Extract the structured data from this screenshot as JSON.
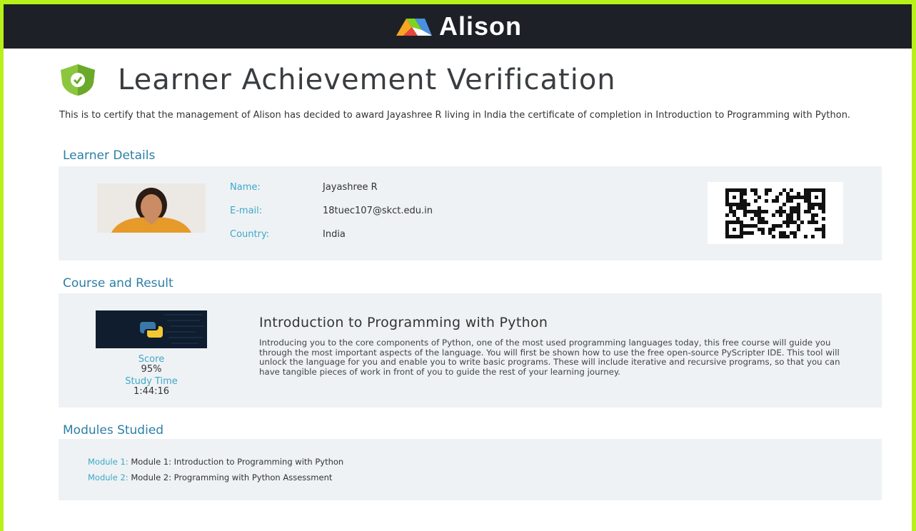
{
  "header": {
    "brand_name": "Alison",
    "bar_color": "#1d2127"
  },
  "page": {
    "title": "Learner Achievement Verification",
    "intro": "This is to certify that the management of Alison has decided to award Jayashree R living in India the certificate of completion in Introduction to Programming with Python.",
    "accent_color": "#2b7fa6",
    "border_color": "#b8f01a"
  },
  "learner": {
    "heading": "Learner Details",
    "name_label": "Name:",
    "name": "Jayashree R",
    "email_label": "E-mail:",
    "email": "18tuec107@skct.edu.in",
    "country_label": "Country:",
    "country": "India",
    "photo_icon": "learner-photo",
    "qr_icon": "qr-code"
  },
  "course": {
    "heading": "Course and Result",
    "title": "Introduction to Programming with Python",
    "description": "Introducing you to the core components of Python, one of the most used programming languages today, this free course will guide you through the most important aspects of the language. You will first be shown how to use the free open-source PyScripter IDE. This tool will unlock the language for you and enable you to write basic programs. These will include iterative and recursive programs, so that you can have tangible pieces of work in front of you to guide the rest of your learning journey.",
    "score_label": "Score",
    "score": "95%",
    "study_time_label": "Study Time",
    "study_time": "1:44:16",
    "thumbnail_icon": "python-logo"
  },
  "modules": {
    "heading": "Modules Studied",
    "items": [
      {
        "label": "Module 1:",
        "value": "Module 1: Introduction to Programming with Python"
      },
      {
        "label": "Module 2:",
        "value": "Module 2: Programming with Python Assessment"
      }
    ]
  }
}
